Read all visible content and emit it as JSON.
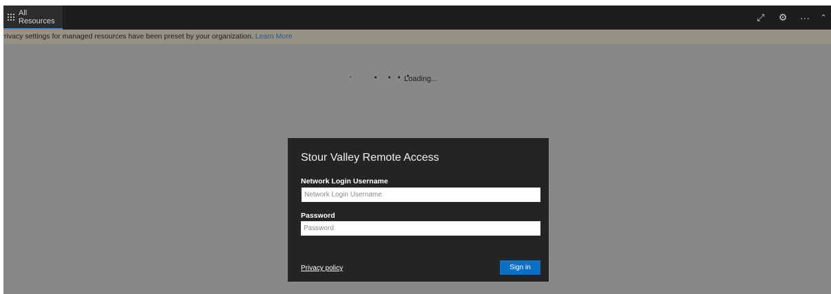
{
  "topbar": {
    "tab_label": "All Resources",
    "icons": [
      "grid-icon",
      "expand-icon",
      "gear-icon",
      "more-icon",
      "chevron-up-icon"
    ],
    "expand_glyph": "⤢",
    "settings_glyph": "⚙",
    "more_glyph": "···",
    "collapse_glyph": "⌃"
  },
  "privacy_bar": {
    "message": "Privacy settings for managed resources have been preset by your organization.",
    "link_label": "Learn More"
  },
  "loader": {
    "text": "Loading..."
  },
  "login": {
    "title": "Stour Valley Remote Access",
    "username_label": "Network Login Username",
    "username_placeholder": "Network Login Username",
    "username_value": "",
    "password_label": "Password",
    "password_placeholder": "Password",
    "password_value": "",
    "privacy_link": "Privacy policy",
    "signin_label": "Sign in"
  },
  "colors": {
    "topbar_bg": "#1d1d1d",
    "overlay_bg": "#888888",
    "privacy_bar_bg": "#949185",
    "dialog_bg": "#242424",
    "signin_bg": "#0a6fc6",
    "tab_accent": "#4a8ad0"
  }
}
